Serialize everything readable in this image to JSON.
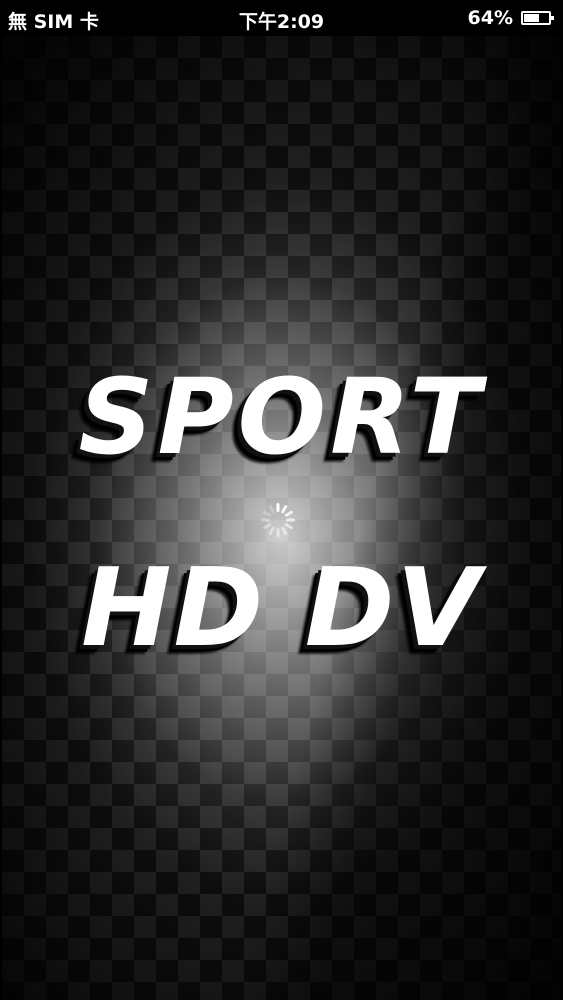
{
  "status_bar": {
    "carrier": "無 SIM 卡",
    "time": "下午2:09",
    "battery_percent": "64%",
    "battery_level": 0.64,
    "battery_icon": "battery-icon"
  },
  "splash": {
    "title_line_1": "SPORT",
    "title_line_2": "HD DV",
    "spinner_icon": "loading-spinner-icon"
  },
  "colors": {
    "background": "#000000",
    "title_text": "#ffffff",
    "checker_dark": "#111111",
    "checker_light": "#2a2a2a"
  }
}
